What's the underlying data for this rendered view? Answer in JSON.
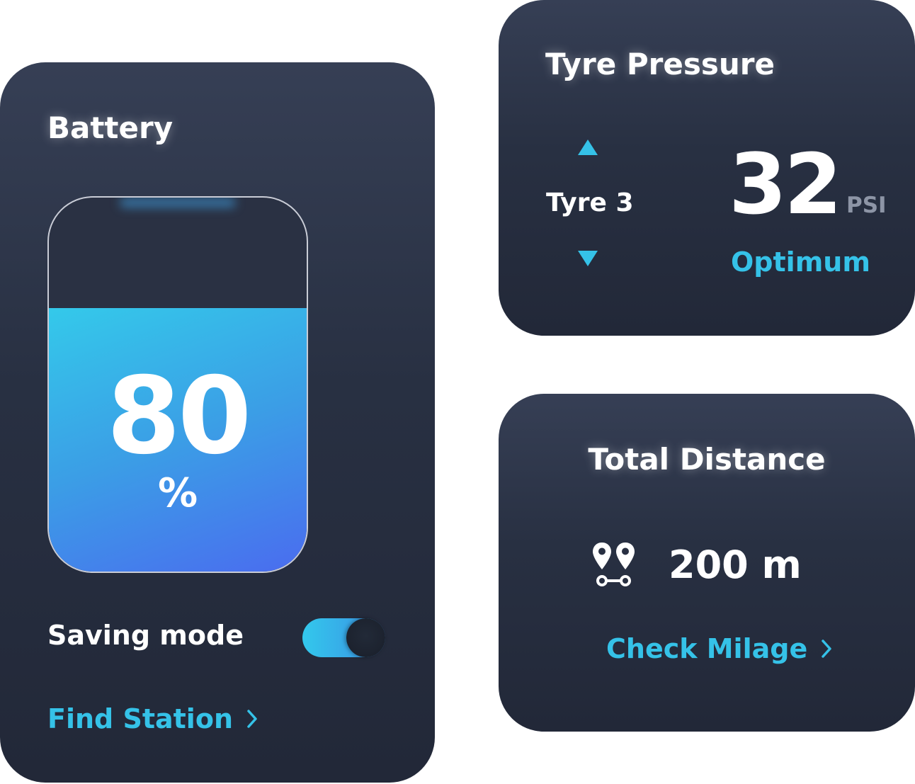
{
  "battery": {
    "title": "Battery",
    "level_percent": 80,
    "value": "80",
    "unit": "%",
    "saving_mode_label": "Saving mode",
    "saving_mode_on": true,
    "find_station_label": "Find Station"
  },
  "tyre": {
    "title": "Tyre Pressure",
    "selected_tyre": "Tyre 3",
    "value": "32",
    "unit": "PSI",
    "status": "Optimum"
  },
  "distance": {
    "title": "Total Distance",
    "value": "200 m",
    "check_label": "Check Milage"
  },
  "colors": {
    "accent": "#35c2e8",
    "card_top": "#363f55",
    "card_bottom": "#222838",
    "muted_text": "#8d95a6",
    "fill_start": "#34c9ea",
    "fill_end": "#4a6cef"
  },
  "icons": {
    "tyre_prev": "chevron-up-icon",
    "tyre_next": "chevron-down-icon",
    "route": "route-icon",
    "link_arrow": "chevron-right-icon"
  }
}
